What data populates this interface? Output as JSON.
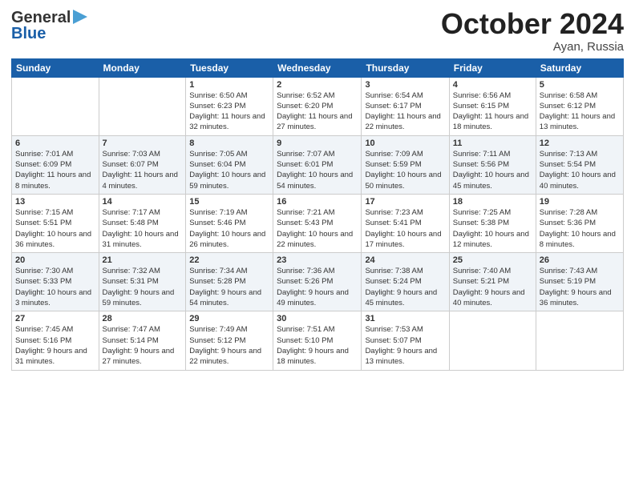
{
  "header": {
    "logo_line1": "General",
    "logo_line2": "Blue",
    "month": "October 2024",
    "location": "Ayan, Russia"
  },
  "weekdays": [
    "Sunday",
    "Monday",
    "Tuesday",
    "Wednesday",
    "Thursday",
    "Friday",
    "Saturday"
  ],
  "weeks": [
    [
      {
        "day": "",
        "sunrise": "",
        "sunset": "",
        "daylight": ""
      },
      {
        "day": "",
        "sunrise": "",
        "sunset": "",
        "daylight": ""
      },
      {
        "day": "1",
        "sunrise": "Sunrise: 6:50 AM",
        "sunset": "Sunset: 6:23 PM",
        "daylight": "Daylight: 11 hours and 32 minutes."
      },
      {
        "day": "2",
        "sunrise": "Sunrise: 6:52 AM",
        "sunset": "Sunset: 6:20 PM",
        "daylight": "Daylight: 11 hours and 27 minutes."
      },
      {
        "day": "3",
        "sunrise": "Sunrise: 6:54 AM",
        "sunset": "Sunset: 6:17 PM",
        "daylight": "Daylight: 11 hours and 22 minutes."
      },
      {
        "day": "4",
        "sunrise": "Sunrise: 6:56 AM",
        "sunset": "Sunset: 6:15 PM",
        "daylight": "Daylight: 11 hours and 18 minutes."
      },
      {
        "day": "5",
        "sunrise": "Sunrise: 6:58 AM",
        "sunset": "Sunset: 6:12 PM",
        "daylight": "Daylight: 11 hours and 13 minutes."
      }
    ],
    [
      {
        "day": "6",
        "sunrise": "Sunrise: 7:01 AM",
        "sunset": "Sunset: 6:09 PM",
        "daylight": "Daylight: 11 hours and 8 minutes."
      },
      {
        "day": "7",
        "sunrise": "Sunrise: 7:03 AM",
        "sunset": "Sunset: 6:07 PM",
        "daylight": "Daylight: 11 hours and 4 minutes."
      },
      {
        "day": "8",
        "sunrise": "Sunrise: 7:05 AM",
        "sunset": "Sunset: 6:04 PM",
        "daylight": "Daylight: 10 hours and 59 minutes."
      },
      {
        "day": "9",
        "sunrise": "Sunrise: 7:07 AM",
        "sunset": "Sunset: 6:01 PM",
        "daylight": "Daylight: 10 hours and 54 minutes."
      },
      {
        "day": "10",
        "sunrise": "Sunrise: 7:09 AM",
        "sunset": "Sunset: 5:59 PM",
        "daylight": "Daylight: 10 hours and 50 minutes."
      },
      {
        "day": "11",
        "sunrise": "Sunrise: 7:11 AM",
        "sunset": "Sunset: 5:56 PM",
        "daylight": "Daylight: 10 hours and 45 minutes."
      },
      {
        "day": "12",
        "sunrise": "Sunrise: 7:13 AM",
        "sunset": "Sunset: 5:54 PM",
        "daylight": "Daylight: 10 hours and 40 minutes."
      }
    ],
    [
      {
        "day": "13",
        "sunrise": "Sunrise: 7:15 AM",
        "sunset": "Sunset: 5:51 PM",
        "daylight": "Daylight: 10 hours and 36 minutes."
      },
      {
        "day": "14",
        "sunrise": "Sunrise: 7:17 AM",
        "sunset": "Sunset: 5:48 PM",
        "daylight": "Daylight: 10 hours and 31 minutes."
      },
      {
        "day": "15",
        "sunrise": "Sunrise: 7:19 AM",
        "sunset": "Sunset: 5:46 PM",
        "daylight": "Daylight: 10 hours and 26 minutes."
      },
      {
        "day": "16",
        "sunrise": "Sunrise: 7:21 AM",
        "sunset": "Sunset: 5:43 PM",
        "daylight": "Daylight: 10 hours and 22 minutes."
      },
      {
        "day": "17",
        "sunrise": "Sunrise: 7:23 AM",
        "sunset": "Sunset: 5:41 PM",
        "daylight": "Daylight: 10 hours and 17 minutes."
      },
      {
        "day": "18",
        "sunrise": "Sunrise: 7:25 AM",
        "sunset": "Sunset: 5:38 PM",
        "daylight": "Daylight: 10 hours and 12 minutes."
      },
      {
        "day": "19",
        "sunrise": "Sunrise: 7:28 AM",
        "sunset": "Sunset: 5:36 PM",
        "daylight": "Daylight: 10 hours and 8 minutes."
      }
    ],
    [
      {
        "day": "20",
        "sunrise": "Sunrise: 7:30 AM",
        "sunset": "Sunset: 5:33 PM",
        "daylight": "Daylight: 10 hours and 3 minutes."
      },
      {
        "day": "21",
        "sunrise": "Sunrise: 7:32 AM",
        "sunset": "Sunset: 5:31 PM",
        "daylight": "Daylight: 9 hours and 59 minutes."
      },
      {
        "day": "22",
        "sunrise": "Sunrise: 7:34 AM",
        "sunset": "Sunset: 5:28 PM",
        "daylight": "Daylight: 9 hours and 54 minutes."
      },
      {
        "day": "23",
        "sunrise": "Sunrise: 7:36 AM",
        "sunset": "Sunset: 5:26 PM",
        "daylight": "Daylight: 9 hours and 49 minutes."
      },
      {
        "day": "24",
        "sunrise": "Sunrise: 7:38 AM",
        "sunset": "Sunset: 5:24 PM",
        "daylight": "Daylight: 9 hours and 45 minutes."
      },
      {
        "day": "25",
        "sunrise": "Sunrise: 7:40 AM",
        "sunset": "Sunset: 5:21 PM",
        "daylight": "Daylight: 9 hours and 40 minutes."
      },
      {
        "day": "26",
        "sunrise": "Sunrise: 7:43 AM",
        "sunset": "Sunset: 5:19 PM",
        "daylight": "Daylight: 9 hours and 36 minutes."
      }
    ],
    [
      {
        "day": "27",
        "sunrise": "Sunrise: 7:45 AM",
        "sunset": "Sunset: 5:16 PM",
        "daylight": "Daylight: 9 hours and 31 minutes."
      },
      {
        "day": "28",
        "sunrise": "Sunrise: 7:47 AM",
        "sunset": "Sunset: 5:14 PM",
        "daylight": "Daylight: 9 hours and 27 minutes."
      },
      {
        "day": "29",
        "sunrise": "Sunrise: 7:49 AM",
        "sunset": "Sunset: 5:12 PM",
        "daylight": "Daylight: 9 hours and 22 minutes."
      },
      {
        "day": "30",
        "sunrise": "Sunrise: 7:51 AM",
        "sunset": "Sunset: 5:10 PM",
        "daylight": "Daylight: 9 hours and 18 minutes."
      },
      {
        "day": "31",
        "sunrise": "Sunrise: 7:53 AM",
        "sunset": "Sunset: 5:07 PM",
        "daylight": "Daylight: 9 hours and 13 minutes."
      },
      {
        "day": "",
        "sunrise": "",
        "sunset": "",
        "daylight": ""
      },
      {
        "day": "",
        "sunrise": "",
        "sunset": "",
        "daylight": ""
      }
    ]
  ]
}
